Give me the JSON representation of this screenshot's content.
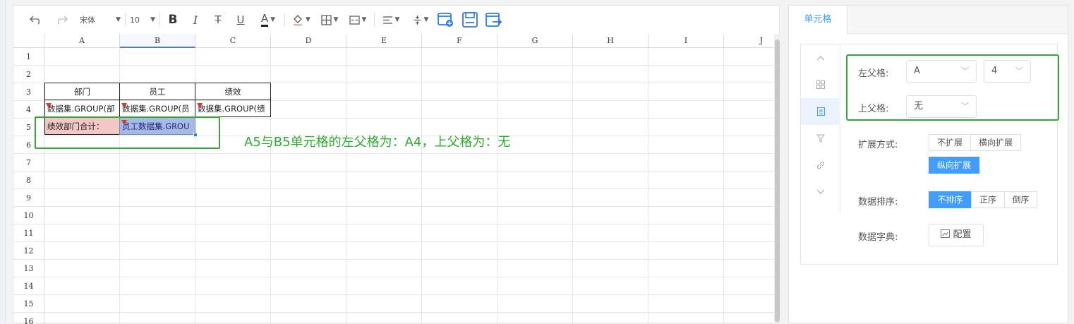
{
  "toolbar": {
    "font_name": "宋体",
    "font_size": "10",
    "bold": "B",
    "italic": "I",
    "strike": "T",
    "underline": "U",
    "font_color": "A"
  },
  "columns": [
    "A",
    "B",
    "C",
    "D",
    "E",
    "F",
    "G",
    "H",
    "I",
    "J"
  ],
  "rows": [
    "1",
    "2",
    "3",
    "4",
    "5",
    "6",
    "7",
    "8",
    "9",
    "10",
    "11",
    "12",
    "13",
    "14",
    "15",
    "16"
  ],
  "cells": {
    "a3": "部门",
    "b3": "员工",
    "c3": "绩效",
    "a4": "数据集.GROUP(部",
    "b4": "数据集.GROUP(员",
    "c4": "数据集.GROUP(绩",
    "a5": "绩效部门合计：",
    "b5": "员工数据集.GROU"
  },
  "annotation": "A5与B5单元格的左父格为：A4，上父格为：无",
  "panel": {
    "tab": "单元格",
    "left_parent_label": "左父格:",
    "left_parent_col": "A",
    "left_parent_row": "4",
    "top_parent_label": "上父格:",
    "top_parent_value": "无",
    "expand_label": "扩展方式:",
    "expand_opts": [
      "不扩展",
      "横向扩展",
      "纵向扩展"
    ],
    "sort_label": "数据排序:",
    "sort_opts": [
      "不排序",
      "正序",
      "倒序"
    ],
    "dict_label": "数据字典:",
    "dict_btn": "配置"
  },
  "colors": {
    "accent": "#409eff",
    "highlight": "#2eab2e",
    "cell_pink": "#f4c7c7",
    "cell_blue": "#a9b9e6"
  }
}
